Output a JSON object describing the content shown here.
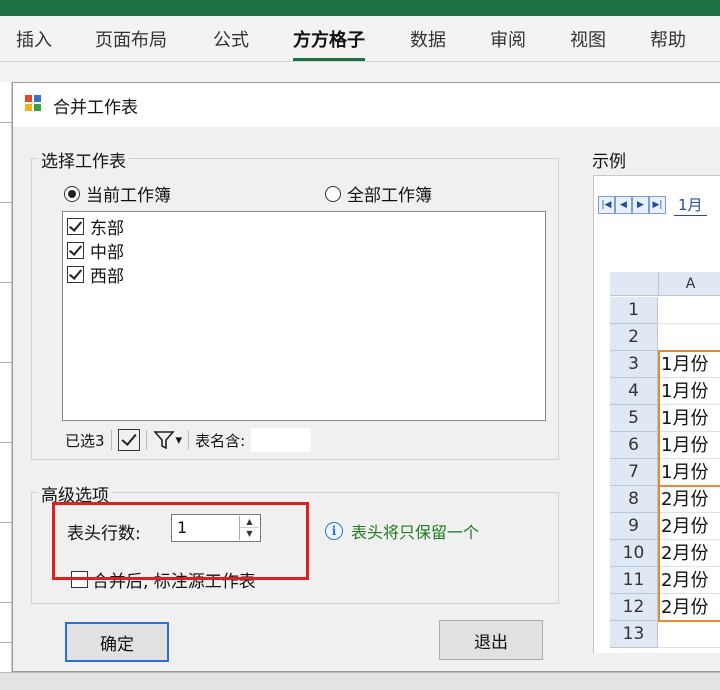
{
  "ribbon": {
    "tabs": [
      "插入",
      "页面布局",
      "公式",
      "方方格子",
      "数据",
      "审阅",
      "视图",
      "帮助"
    ],
    "active_index": 3
  },
  "dialog": {
    "title": "合并工作表",
    "select_group": {
      "label": "选择工作表",
      "radio_current": "当前工作簿",
      "radio_all": "全部工作簿",
      "selected_radio": "current",
      "sheets": [
        {
          "name": "东部",
          "checked": true
        },
        {
          "name": "中部",
          "checked": true
        },
        {
          "name": "西部",
          "checked": true
        }
      ],
      "selected_count_label": "已选3",
      "name_contains_label": "表名含:",
      "filter_caret": "▾"
    },
    "advanced_group": {
      "label": "高级选项",
      "header_rows_label": "表头行数:",
      "header_rows_value": "1",
      "info_text": "表头将只保留一个",
      "mark_source_label": "合并后, 标注源工作表",
      "mark_source_checked": false
    },
    "buttons": {
      "ok": "确定",
      "exit": "退出"
    },
    "example": {
      "label": "示例",
      "sheet_tab": "1月",
      "column_header": "A",
      "rows": [
        {
          "num": "1",
          "value": ""
        },
        {
          "num": "2",
          "value": ""
        },
        {
          "num": "3",
          "value": "1月份"
        },
        {
          "num": "4",
          "value": "1月份"
        },
        {
          "num": "5",
          "value": "1月份"
        },
        {
          "num": "6",
          "value": "1月份"
        },
        {
          "num": "7",
          "value": "1月份"
        },
        {
          "num": "8",
          "value": "2月份"
        },
        {
          "num": "9",
          "value": "2月份"
        },
        {
          "num": "10",
          "value": "2月份"
        },
        {
          "num": "11",
          "value": "2月份"
        },
        {
          "num": "12",
          "value": "2月份"
        },
        {
          "num": "13",
          "value": ""
        }
      ]
    }
  },
  "colors": {
    "excel_green": "#1e7045",
    "highlight_red": "#e02020",
    "example_orange": "#e88a2a",
    "info_green": "#1d7a1d"
  }
}
